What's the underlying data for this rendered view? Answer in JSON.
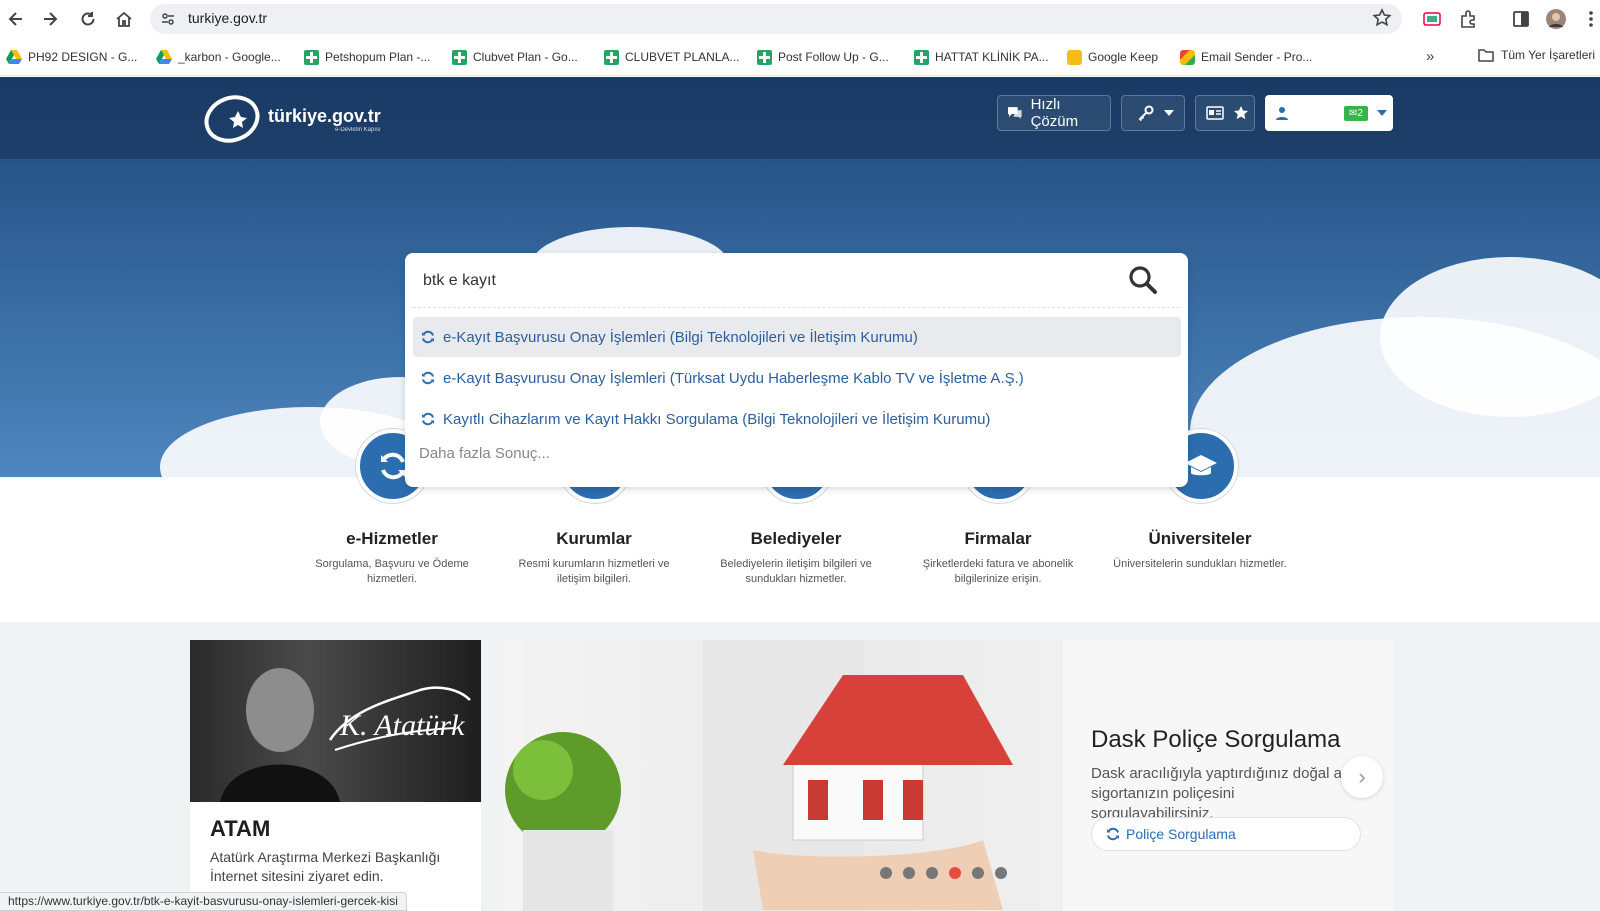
{
  "browser": {
    "url": "turkiye.gov.tr",
    "bookmarks": [
      {
        "label": "PH92 DESIGN - G...",
        "icon": "drive-icon"
      },
      {
        "label": "_karbon - Google...",
        "icon": "drive-icon"
      },
      {
        "label": "Petshopum Plan -...",
        "icon": "sheets-icon"
      },
      {
        "label": "Clubvet Plan - Go...",
        "icon": "sheets-icon"
      },
      {
        "label": "CLUBVET PLANLA...",
        "icon": "sheets-icon"
      },
      {
        "label": "Post Follow Up - G...",
        "icon": "sheets-icon"
      },
      {
        "label": "HATTAT KLİNİK PA...",
        "icon": "sheets-icon"
      },
      {
        "label": "Google Keep",
        "icon": "keep-icon"
      },
      {
        "label": "Email Sender - Pro...",
        "icon": "app-icon"
      }
    ],
    "more_bookmarks": "»",
    "all_bookmarks": "Tüm Yer İşaretleri",
    "status_url": "https://www.turkiye.gov.tr/btk-e-kayit-basvurusu-onay-islemleri-gercek-kisi"
  },
  "header": {
    "logo_text": "türkiye.gov.tr",
    "logo_tagline": "e-Devletin Kapısı",
    "quick_solution": "Hızlı Çözüm",
    "mail_count": "2"
  },
  "search": {
    "query": "btk e kayıt",
    "suggestions": [
      "e-Kayıt Başvurusu Onay İşlemleri (Bilgi Teknolojileri ve İletişim Kurumu)",
      "e-Kayıt Başvurusu Onay İşlemleri (Türksat Uydu Haberleşme Kablo TV ve İşletme A.Ş.)",
      "Kayıtlı Cihazlarım ve Kayıt Hakkı Sorgulama (Bilgi Teknolojileri ve İletişim Kurumu)"
    ],
    "more": "Daha fazla Sonuç..."
  },
  "categories": [
    {
      "title": "e-Hizmetler",
      "desc": "Sorgulama, Başvuru ve Ödeme hizmetleri."
    },
    {
      "title": "Kurumlar",
      "desc": "Resmi kurumların hizmetleri ve iletişim bilgileri."
    },
    {
      "title": "Belediyeler",
      "desc": "Belediyelerin iletişim bilgileri ve sundukları hizmetler."
    },
    {
      "title": "Firmalar",
      "desc": "Şirketlerdeki fatura ve abonelik bilgilerinize erişin."
    },
    {
      "title": "Üniversiteler",
      "desc": "Üniversitelerin sundukları hizmetler."
    }
  ],
  "atam": {
    "signature": "K. Atatürk",
    "title": "ATAM",
    "desc": "Atatürk Araştırma Merkezi Başkanlığı İnternet sitesini ziyaret edin."
  },
  "slider": {
    "title": "Dask Poliçe Sorgulama",
    "desc": "Dask aracılığıyla yaptırdığınız doğal afet sigortanızın poliçesini sorgulayabilirsiniz.",
    "button": "Poliçe Sorgulama",
    "slide_count": 6,
    "active_slide": 4
  },
  "colors": {
    "brand_blue": "#2c6db0",
    "link_blue": "#2c5f9e",
    "active_dot": "#e84c3d",
    "mail_badge": "#37b34a"
  }
}
